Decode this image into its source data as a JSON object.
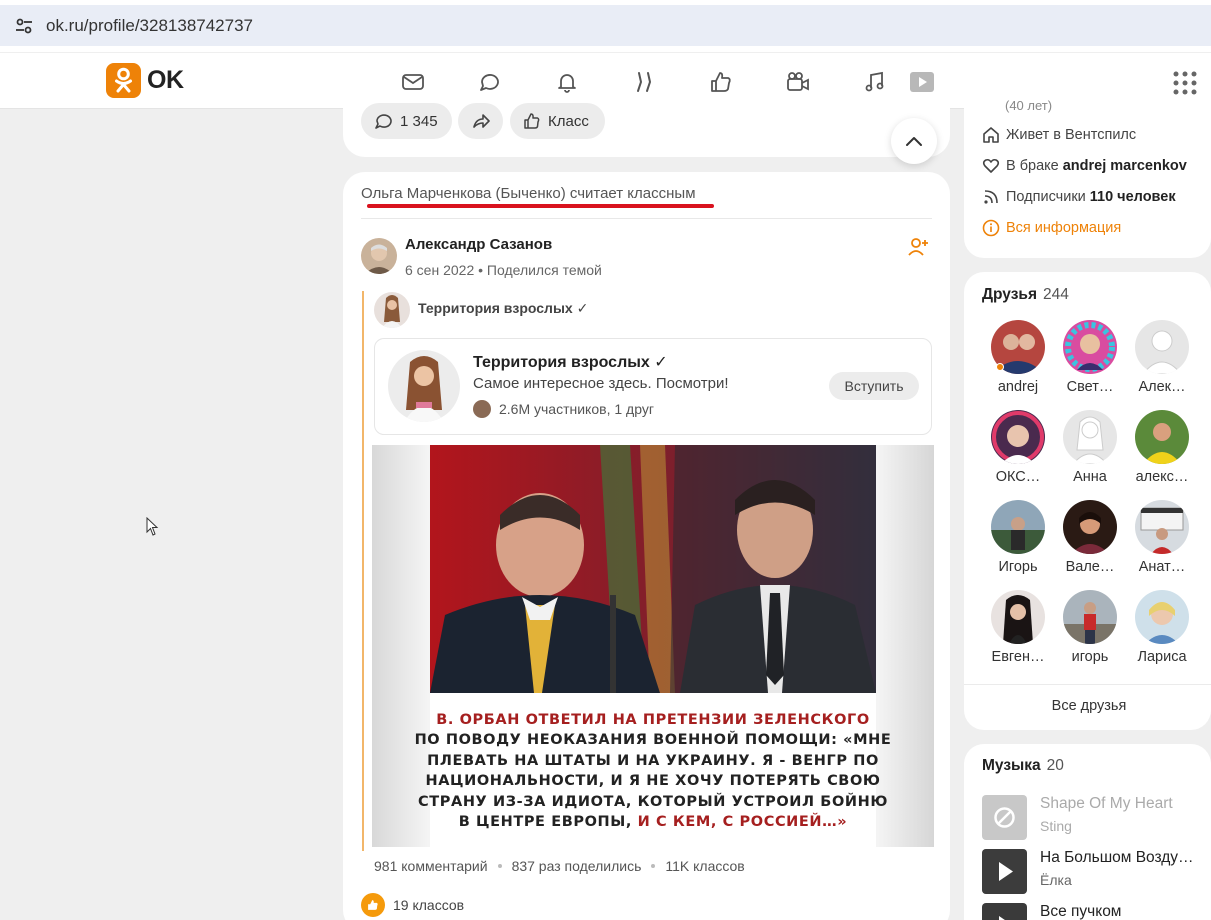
{
  "browser": {
    "url": "ok.ru/profile/328138742737"
  },
  "header": {
    "logo_text": "OK",
    "nav_icons": [
      "mail-icon",
      "chat-icon",
      "bell-icon",
      "guests-icon",
      "like-icon",
      "video-icon",
      "music-icon",
      "play-icon"
    ],
    "accent": "#ee8208"
  },
  "top_actions": {
    "comments": "1 345",
    "klass": "Класс"
  },
  "feed": {
    "liker_line": "Ольга Марченкова (Быченко) считает классным",
    "author": "Александр Сазанов",
    "meta": "6 сен 2022 • Поделился темой",
    "group_small": "Территория взрослых ✓",
    "group": {
      "name": "Территория взрослых ✓",
      "desc": "Самое интересное здесь. Посмотри!",
      "members": "2.6M участников, 1 друг",
      "join": "Вступить"
    },
    "caption_lines": [
      {
        "a": "В. ОРБАН ОТВЕТИЛ НА ПРЕТЕНЗИИ ЗЕЛЕНСКОГО",
        "b": ""
      },
      {
        "a": "ПО ПОВОДУ НЕОКАЗАНИЯ ВОЕННОЙ ПОМОЩИ: «МНЕ",
        "b": ""
      },
      {
        "a": "ПЛЕВАТЬ НА ШТАТЫ И НА УКРАИНУ. Я - ВЕНГР ПО",
        "b": ""
      },
      {
        "a": "НАЦИОНАЛЬНОСТИ, И Я НЕ ХОЧУ ПОТЕРЯТЬ СВОЮ",
        "b": ""
      },
      {
        "a": "СТРАНУ ИЗ-ЗА ИДИОТА, КОТОРЫЙ УСТРОИЛ БОЙНЮ",
        "b": ""
      },
      {
        "a": "В ЦЕНТРЕ ЕВРОПЫ, ",
        "b": "И С КЕМ, С РОССИЕЙ…»"
      }
    ],
    "stats": {
      "comments": "981 комментарий",
      "shares": "837 раз поделились",
      "klasses": "11K классов"
    },
    "likes": "19 классов"
  },
  "profile_info": {
    "age_partial": "(40 лет)",
    "city": "Живет в Вентспилс",
    "marriage_prefix": "В браке",
    "marriage_name": "andrej marcenkov",
    "subs_prefix": "Подписчики",
    "subs_count": "110 человек",
    "all_info": "Вся информация"
  },
  "friends": {
    "title": "Друзья",
    "count": "244",
    "items": [
      {
        "name": "andrej"
      },
      {
        "name": "Свет…"
      },
      {
        "name": "Алек…"
      },
      {
        "name": "ОКС…"
      },
      {
        "name": "Анна"
      },
      {
        "name": "алекс…"
      },
      {
        "name": "Игорь"
      },
      {
        "name": "Вале…"
      },
      {
        "name": "Анат…"
      },
      {
        "name": "Евген…"
      },
      {
        "name": "игорь"
      },
      {
        "name": "Лариса"
      }
    ],
    "all": "Все друзья"
  },
  "music": {
    "title": "Музыка",
    "count": "20",
    "tracks": [
      {
        "title": "Shape Of My Heart",
        "artist": "Sting"
      },
      {
        "title": "На Большом Возду…",
        "artist": "Ёлка"
      },
      {
        "title": "Все пучком",
        "artist": ""
      }
    ]
  }
}
